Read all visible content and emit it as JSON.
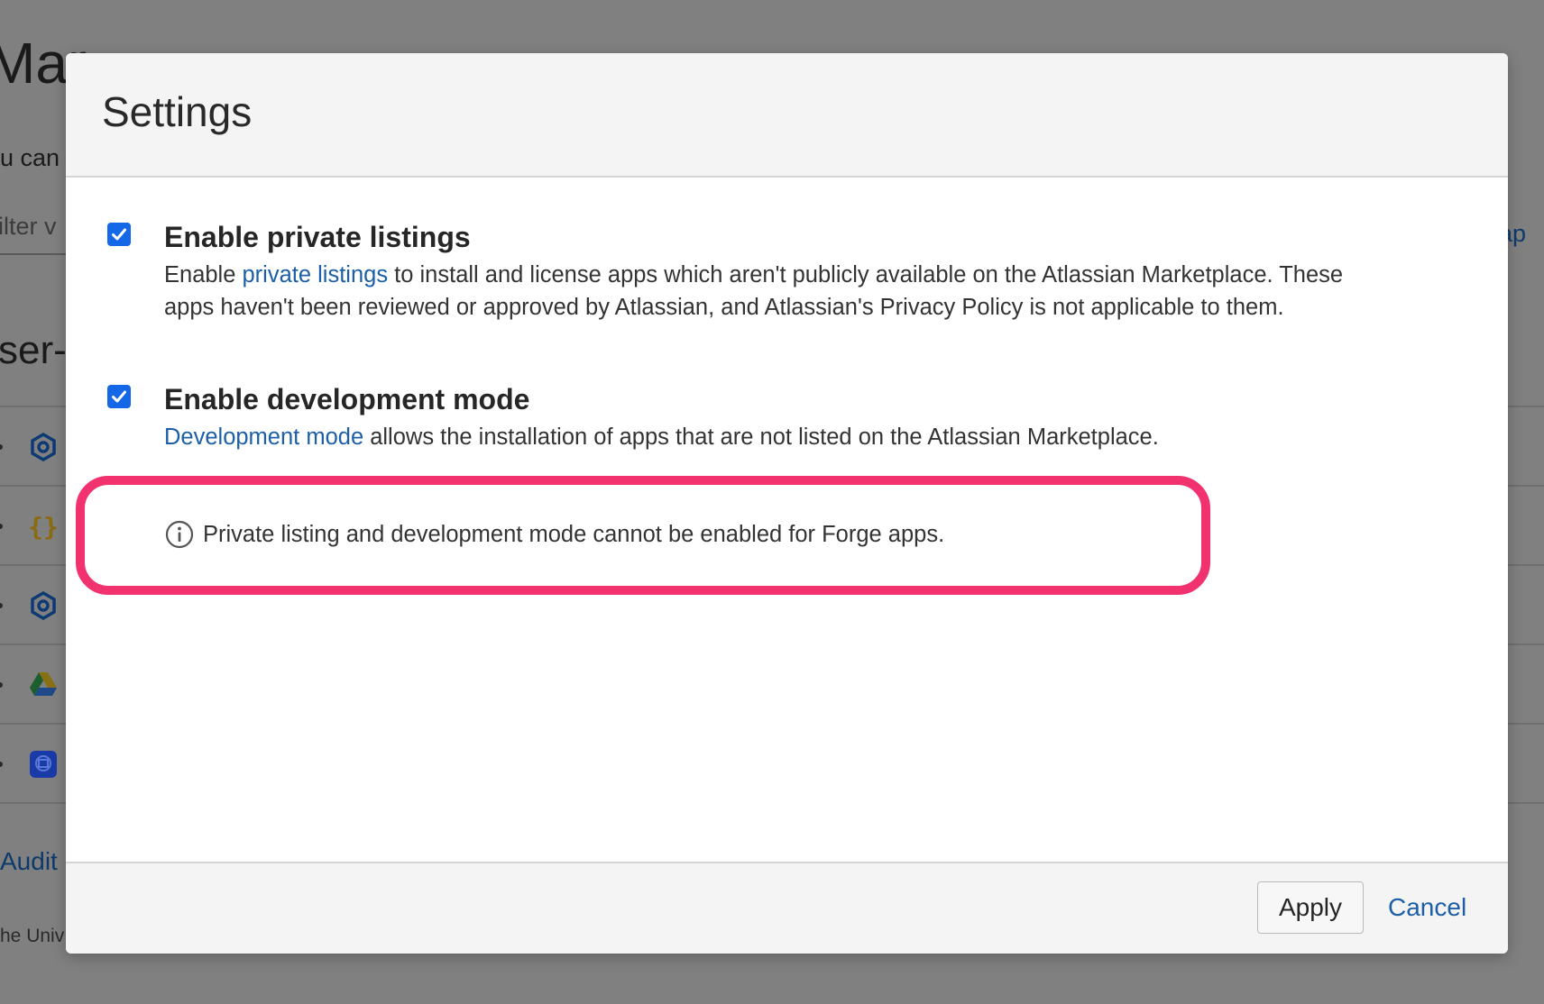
{
  "background": {
    "title_fragment": "Mar",
    "desc_fragment": "u can",
    "filter_fragment": "ilter v",
    "right_link_fragment": "ap",
    "section_fragment": "ser-",
    "audit_fragment": "Audit l",
    "footer_fragment": "he Univ",
    "row_icons": [
      "hexagon-ring-icon",
      "braces-icon",
      "hexagon-ring-icon",
      "google-drive-icon",
      "blue-app-icon"
    ]
  },
  "dialog": {
    "title": "Settings",
    "settings": [
      {
        "title": "Enable private listings",
        "checked": true,
        "desc_prefix": "Enable ",
        "desc_link": "private listings",
        "desc_suffix": " to install and license apps which aren't publicly available on the Atlassian Marketplace. These apps haven't been reviewed or approved by Atlassian, and Atlassian's Privacy Policy is not applicable to them."
      },
      {
        "title": "Enable development mode",
        "checked": true,
        "desc_link": "Development mode",
        "desc_suffix": " allows the installation of apps that are not listed on the Atlassian Marketplace."
      }
    ],
    "info_note": "Private listing and development mode cannot be enabled for Forge apps.",
    "apply_label": "Apply",
    "cancel_label": "Cancel"
  },
  "colors": {
    "overlay": "#808080",
    "checkbox": "#1467e6",
    "link": "#1c5fa8",
    "highlight": "#f2316f"
  }
}
